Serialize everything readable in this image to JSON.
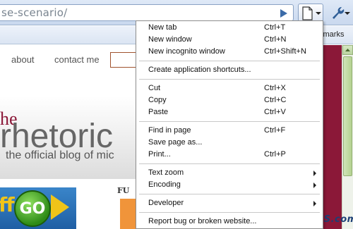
{
  "toolbar": {
    "url_fragment": "se-scenario/"
  },
  "bookmarks_bar": {
    "visible_text": "kmarks"
  },
  "page": {
    "nav": {
      "about": "about",
      "contact": "contact me"
    },
    "brand_prefix": "he",
    "brand_name": "rhetoric",
    "tagline": "the official blog of mic",
    "ad_left": {
      "letter": "ff",
      "button": "GO"
    },
    "ad_mid": {
      "text": "FU"
    }
  },
  "watermark": "FUTURELOOKS.com",
  "menu": {
    "groups": [
      [
        {
          "label": "New tab",
          "shortcut": "Ctrl+T"
        },
        {
          "label": "New window",
          "shortcut": "Ctrl+N"
        },
        {
          "label": "New incognito window",
          "shortcut": "Ctrl+Shift+N"
        }
      ],
      [
        {
          "label": "Create application shortcuts...",
          "shortcut": ""
        }
      ],
      [
        {
          "label": "Cut",
          "shortcut": "Ctrl+X"
        },
        {
          "label": "Copy",
          "shortcut": "Ctrl+C"
        },
        {
          "label": "Paste",
          "shortcut": "Ctrl+V"
        }
      ],
      [
        {
          "label": "Find in page",
          "shortcut": "Ctrl+F"
        },
        {
          "label": "Save page as...",
          "shortcut": ""
        },
        {
          "label": "Print...",
          "shortcut": "Ctrl+P"
        }
      ],
      [
        {
          "label": "Text zoom",
          "shortcut": "",
          "submenu": true
        },
        {
          "label": "Encoding",
          "shortcut": "",
          "submenu": true
        }
      ],
      [
        {
          "label": "Developer",
          "shortcut": "",
          "submenu": true
        }
      ],
      [
        {
          "label": "Report bug or broken website...",
          "shortcut": ""
        }
      ]
    ]
  },
  "colors": {
    "accent": "#8b1838",
    "toolbar": "#c9d8ee",
    "scroll_thumb": "#b4d290"
  }
}
